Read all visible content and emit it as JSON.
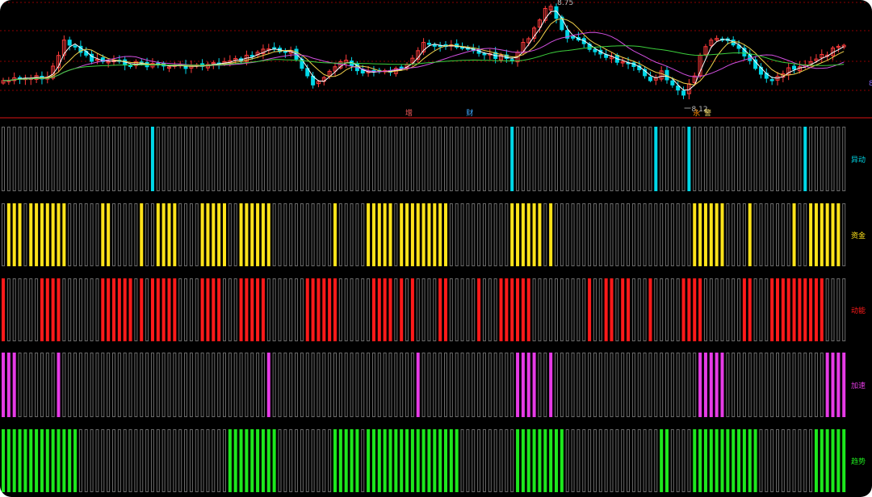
{
  "colors": {
    "background": "#000000",
    "grid": "#8b0000",
    "up": "#ff3b3b",
    "down": "#00d8e8",
    "inactive_stroke": "#6b6b6b",
    "ma5": "#ffffff",
    "ma10": "#f2d14a",
    "ma20": "#d24fe0",
    "ma60": "#3ccf3c"
  },
  "price_chart": {
    "high_label": "8.75",
    "low_label": "8.12",
    "right_tick": "8",
    "markers": [
      {
        "bar": 73,
        "text": "增",
        "color": "#ff6060"
      },
      {
        "bar": 84,
        "text": "财",
        "color": "#3fa9ff"
      },
      {
        "bar": 125,
        "text": "永",
        "color": "#ff8a00"
      },
      {
        "bar": 127,
        "text": "警",
        "color": "#ffe36b"
      }
    ]
  },
  "chart_data": {
    "type": "candlestick with signal-bar panels",
    "bar_count": 153,
    "indicators": [
      {
        "label": "异动",
        "color": "#00d8e8",
        "active_ranges": [
          [
            27,
            27
          ],
          [
            92,
            92
          ],
          [
            118,
            118
          ],
          [
            124,
            124
          ],
          [
            145,
            145
          ]
        ]
      },
      {
        "label": "资金",
        "color": "#ffe31a",
        "active_ranges": [
          [
            1,
            3
          ],
          [
            5,
            11
          ],
          [
            18,
            19
          ],
          [
            25,
            25
          ],
          [
            28,
            31
          ],
          [
            36,
            40
          ],
          [
            43,
            48
          ],
          [
            60,
            60
          ],
          [
            66,
            70
          ],
          [
            72,
            80
          ],
          [
            92,
            97
          ],
          [
            99,
            99
          ],
          [
            125,
            130
          ],
          [
            135,
            135
          ],
          [
            143,
            143
          ],
          [
            146,
            151
          ]
        ]
      },
      {
        "label": "动能",
        "color": "#ff1a1a",
        "active_ranges": [
          [
            0,
            0
          ],
          [
            7,
            10
          ],
          [
            18,
            23
          ],
          [
            25,
            25
          ],
          [
            27,
            31
          ],
          [
            36,
            39
          ],
          [
            43,
            47
          ],
          [
            55,
            60
          ],
          [
            67,
            70
          ],
          [
            72,
            72
          ],
          [
            74,
            74
          ],
          [
            79,
            80
          ],
          [
            86,
            86
          ],
          [
            90,
            95
          ],
          [
            106,
            106
          ],
          [
            109,
            110
          ],
          [
            112,
            113
          ],
          [
            117,
            117
          ],
          [
            123,
            126
          ],
          [
            134,
            135
          ],
          [
            139,
            148
          ]
        ]
      },
      {
        "label": "加速",
        "color": "#e63be6",
        "active_ranges": [
          [
            0,
            2
          ],
          [
            10,
            10
          ],
          [
            48,
            48
          ],
          [
            75,
            75
          ],
          [
            93,
            96
          ],
          [
            99,
            99
          ],
          [
            126,
            130
          ],
          [
            149,
            152
          ]
        ]
      },
      {
        "label": "趋势",
        "color": "#1de81d",
        "active_ranges": [
          [
            0,
            13
          ],
          [
            41,
            49
          ],
          [
            60,
            64
          ],
          [
            66,
            82
          ],
          [
            93,
            101
          ],
          [
            119,
            120
          ],
          [
            125,
            136
          ],
          [
            147,
            152
          ]
        ]
      }
    ]
  }
}
